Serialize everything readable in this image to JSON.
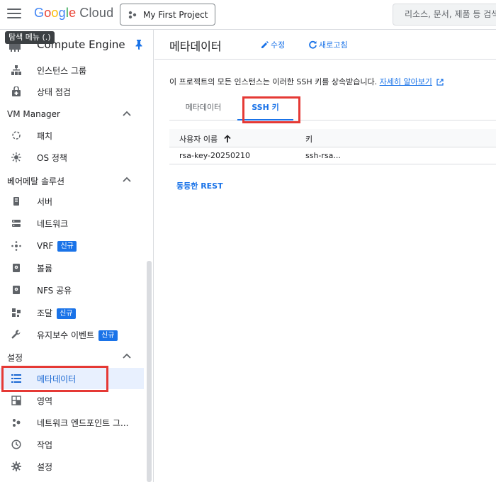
{
  "topbar": {
    "logo_letters": [
      "G",
      "o",
      "o",
      "g",
      "l",
      "e"
    ],
    "logo_cloud": "Cloud",
    "project": "My First Project",
    "search_placeholder": "리소스, 문서, 제품 등 검색"
  },
  "tooltip": "탐색 메뉴 (.)",
  "sidebar": {
    "product_title": "Compute Engine",
    "items": [
      {
        "id": "instance-groups",
        "label": "인스턴스 그룹",
        "icon": "instance-groups-icon"
      },
      {
        "id": "health-checks",
        "label": "상태 점검",
        "icon": "health-check-icon"
      }
    ],
    "sections": [
      {
        "label": "VM Manager"
      },
      {
        "label": "베어메탈 솔루션"
      },
      {
        "label": "설정"
      }
    ],
    "vm_manager_items": [
      {
        "label": "패치",
        "icon": "patch-icon"
      },
      {
        "label": "OS 정책",
        "icon": "os-policy-icon"
      }
    ],
    "baremetal_items": [
      {
        "label": "서버",
        "icon": "server-icon",
        "badge": ""
      },
      {
        "label": "네트워크",
        "icon": "network-icon",
        "badge": ""
      },
      {
        "label": "VRF",
        "icon": "vrf-icon",
        "badge": "신규"
      },
      {
        "label": "볼륨",
        "icon": "volume-icon",
        "badge": ""
      },
      {
        "label": "NFS 공유",
        "icon": "nfs-share-icon",
        "badge": ""
      },
      {
        "label": "조달",
        "icon": "procurement-icon",
        "badge": "신규"
      },
      {
        "label": "유지보수 이벤트",
        "icon": "wrench-icon",
        "badge": "신규"
      }
    ],
    "settings_items": [
      {
        "label": "메타데이터",
        "icon": "metadata-icon",
        "active": true
      },
      {
        "label": "영역",
        "icon": "zones-icon"
      },
      {
        "label": "네트워크 엔드포인트 그...",
        "icon": "network-endpoint-icon"
      },
      {
        "label": "작업",
        "icon": "clock-icon"
      },
      {
        "label": "설정",
        "icon": "gear-icon"
      }
    ]
  },
  "main": {
    "title": "메타데이터",
    "edit_label": "수정",
    "refresh_label": "새로고침",
    "description": "이 프로젝트의 모든 인스턴스는 이러한 SSH 키를 상속받습니다.",
    "learn_more": "자세히 알아보기",
    "tabs": [
      "메타데이터",
      "SSH 키"
    ],
    "active_tab": "SSH 키",
    "table": {
      "headers": [
        "사용자 이름",
        "키"
      ],
      "rows": [
        {
          "username": "rsa-key-20250210",
          "key": "ssh-rsa..."
        }
      ]
    },
    "rest_link": "동등한 REST"
  },
  "colors": {
    "accent": "#1a73e8",
    "active_bg": "#e8f0fe",
    "highlight": "#e53935"
  }
}
